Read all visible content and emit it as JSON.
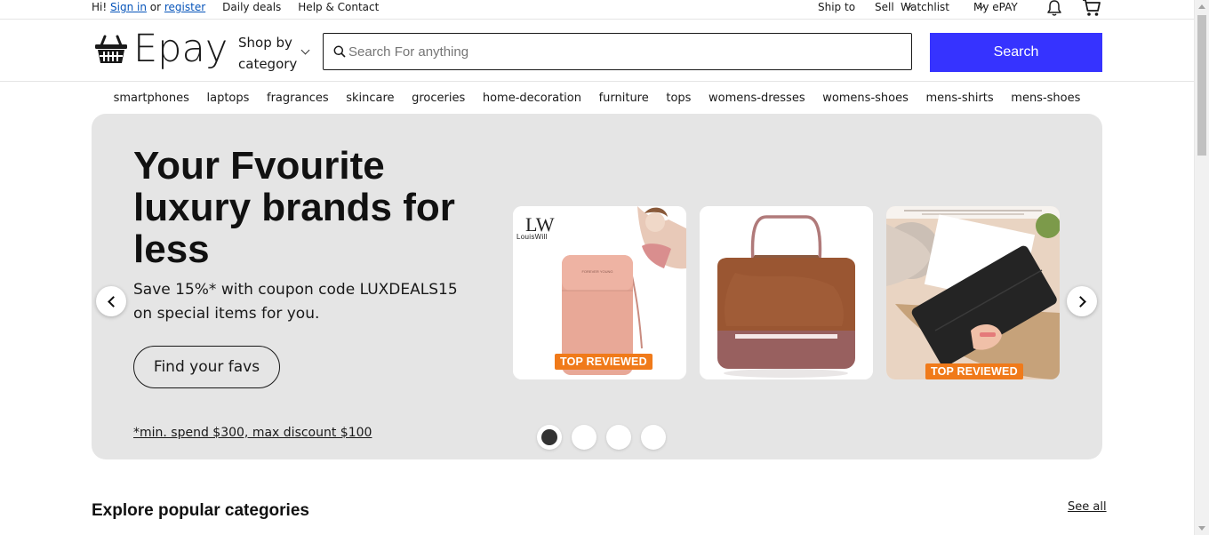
{
  "topbar": {
    "greeting": "Hi!",
    "sign_in": "Sign in",
    "or": "or",
    "register": "register",
    "daily_deals": "Daily deals",
    "help": "Help & Contact",
    "ship_to": "Ship to",
    "sell": "Sell",
    "watchlist": "Watchlist",
    "my_epay": "My ePAY"
  },
  "header": {
    "logo": "Epay",
    "shop_by_line1": "Shop by",
    "shop_by_line2": "category",
    "search_placeholder": "Search For anything",
    "search_button": "Search"
  },
  "categories": [
    "smartphones",
    "laptops",
    "fragrances",
    "skincare",
    "groceries",
    "home-decoration",
    "furniture",
    "tops",
    "womens-dresses",
    "womens-shoes",
    "mens-shirts",
    "mens-shoes"
  ],
  "hero": {
    "title": "Your Fvourite luxury brands for less",
    "subtitle": "Save 15%* with coupon code LUXDEALS15 on special items for you.",
    "cta": "Find your favs",
    "note": "*min. spend $300, max discount $100",
    "card1_brand_mark": "LW",
    "card1_brand": "LouisWill",
    "card1_badge": "TOP REVIEWED",
    "card3_badge": "TOP REVIEWED",
    "active_slide": 1,
    "slide_count": 4
  },
  "explore": {
    "title": "Explore popular categories",
    "see_all": "See all"
  },
  "colors": {
    "accent": "#3633ff",
    "hero_bg": "#e5e5e5",
    "badge": "#f07a1a"
  }
}
